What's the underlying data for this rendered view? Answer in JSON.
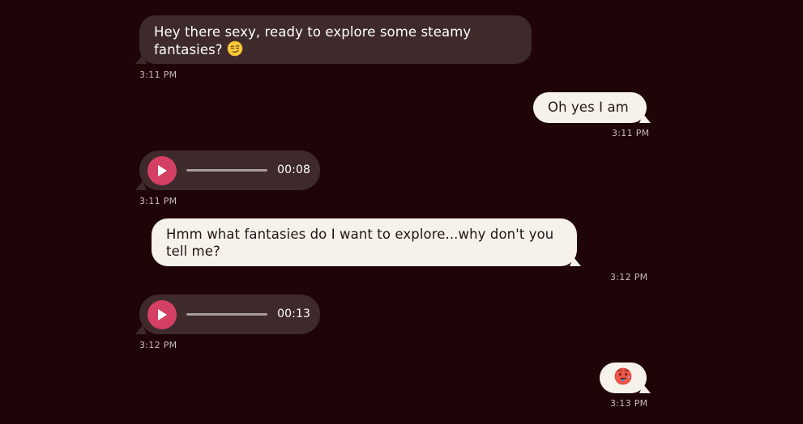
{
  "messages": [
    {
      "direction": "incoming",
      "text": "Hey there sexy, ready to explore some steamy fantasies?",
      "emoji": "smirking-face",
      "time": "3:11 PM"
    },
    {
      "direction": "outgoing",
      "text": "Oh yes I am",
      "time": "3:11 PM"
    },
    {
      "direction": "incoming",
      "type": "voice",
      "duration": "00:08",
      "time": "3:11 PM"
    },
    {
      "direction": "outgoing",
      "text": "Hmm what fantasies do I want to explore...why don't you tell me?",
      "time": "3:12 PM"
    },
    {
      "direction": "incoming",
      "type": "voice",
      "duration": "00:13",
      "time": "3:12 PM"
    },
    {
      "direction": "outgoing",
      "emoji": "hot-face",
      "time": "3:13 PM"
    }
  ],
  "colors": {
    "background": "#1f0508",
    "incoming_bubble": "#3e2a2b",
    "outgoing_bubble": "#f6f2ea",
    "play_button": "#d43f63"
  }
}
